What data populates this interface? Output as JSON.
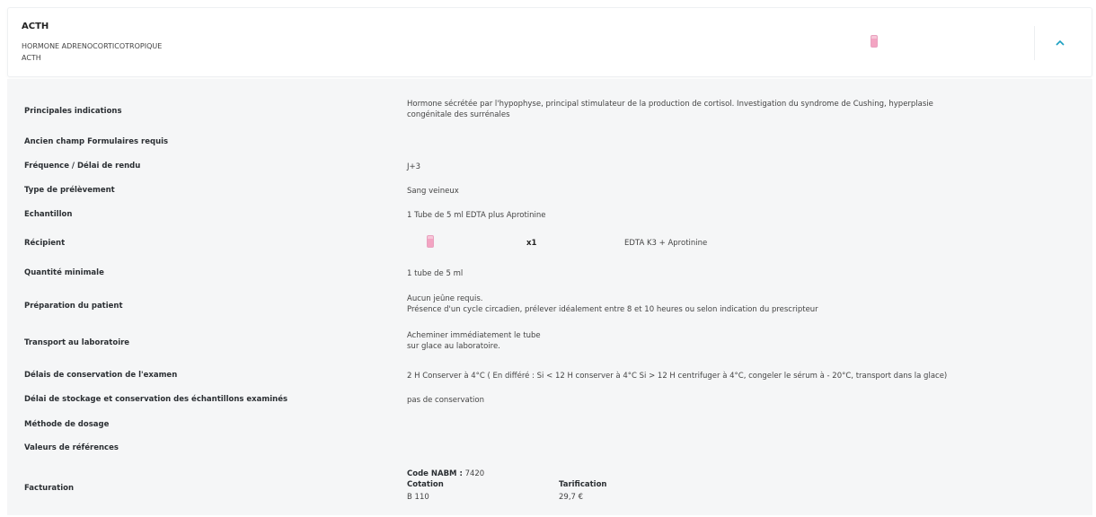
{
  "header": {
    "code": "ACTH",
    "full_name": "HORMONE ADRENOCORTICOTROPIQUE",
    "abbreviation": "ACTH",
    "tube_icon": "pink-tube-icon",
    "toggle_icon": "chevron-up-icon",
    "accent_color": "#1a9fc1"
  },
  "details": {
    "indications_label": "Principales indications",
    "indications_value_line1": "Hormone sécrétée par l'hypophyse, principal stimulateur de la production de cortisol. Investigation du syndrome de Cushing, hyperplasie",
    "indications_value_line2": "congénitale des surrénales",
    "ancien_label": "Ancien champ Formulaires requis",
    "frequence_label": "Fréquence / Délai de rendu",
    "frequence_value": "J+3",
    "type_label": "Type de prélèvement",
    "type_value": "Sang veineux",
    "echantillon_label": "Echantillon",
    "echantillon_value": "1 Tube de 5 ml EDTA plus Aprotinine",
    "recipient_label": "Récipient",
    "recipient_qty": "x1",
    "recipient_type": "EDTA K3 + Aprotinine",
    "quantite_label": "Quantité minimale",
    "quantite_value": "1 tube de 5 ml",
    "preparation_label": "Préparation du patient",
    "preparation_value_line1": "Aucun jeûne requis.",
    "preparation_value_line2": "Présence d'un cycle circadien, prélever idéalement entre 8 et 10 heures ou selon indication du prescripteur",
    "transport_label": "Transport au laboratoire",
    "transport_value_line1": "Acheminer immédiatement le tube",
    "transport_value_line2": "sur glace au laboratoire.",
    "delais_label": "Délais de conservation de l'examen",
    "delais_value": "2 H Conserver à 4°C ( En différé : Si < 12 H conserver à 4°C Si > 12 H centrifuger à 4°C, congeler le sérum à - 20°C, transport dans la glace)",
    "stockage_label": "Délai de stockage et conservation des échantillons examinés",
    "stockage_value": "pas de conservation",
    "methode_label": "Méthode de dosage",
    "valeurs_label": "Valeurs de références",
    "facturation_label": "Facturation",
    "nabm_label": "Code NABM :",
    "nabm_value": "7420",
    "cotation_label": "Cotation",
    "cotation_value": "B 110",
    "tarification_label": "Tarification",
    "tarification_value": "29,7 €"
  }
}
